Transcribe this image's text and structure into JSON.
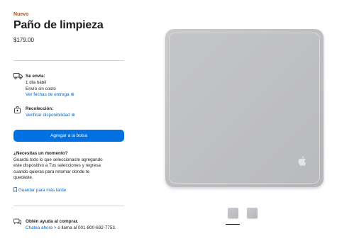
{
  "product": {
    "badge": "Nuevo",
    "title": "Paño de limpieza",
    "price": "$179.00"
  },
  "shipping": {
    "label": "Se envía:",
    "line1": "1 día hábil",
    "line2": "Envío sin costo",
    "link": "Ver fechas de entrega",
    "icon": "truck-icon"
  },
  "pickup": {
    "label": "Recolección:",
    "link": "Verificar disponibilidad",
    "icon": "store-bag-icon"
  },
  "add_to_bag": {
    "label": "Agregar a la bolsa",
    "color": "#0071e3"
  },
  "save_for_later": {
    "heading": "¿Necesitas un momento?",
    "body_lines": [
      "Guarda todo lo que seleccionaste agregando",
      "este dispositivo a Tus selecciones y regresa",
      "cuando quieras para retomar donde te",
      "quedaste."
    ],
    "link": "Guardar para más tarde",
    "icon": "bookmark-icon"
  },
  "help": {
    "title": "Obtén ayuda al comprar.",
    "chat_link": "Chatea ahora",
    "chat_arrow": ">",
    "rest": "o llama al 001-800-692-7753.",
    "icon": "chat-bubbles-icon"
  },
  "gallery": {
    "thumbnails_count": 2,
    "selected_index": 0
  },
  "colors": {
    "accent": "#0066cc",
    "badge": "#bf4800",
    "button": "#0071e3"
  }
}
